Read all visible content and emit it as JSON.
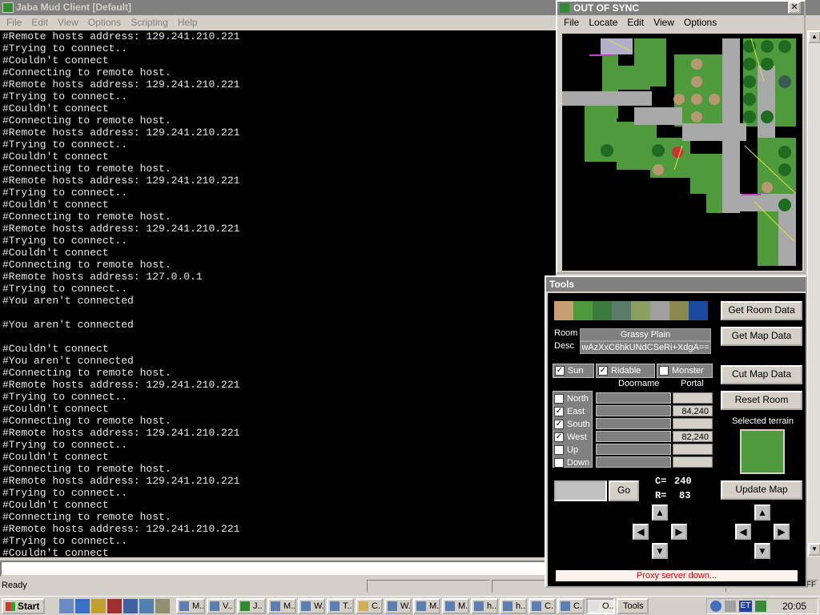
{
  "main": {
    "title": "Jaba Mud Client [Default]",
    "menu": [
      "File",
      "Edit",
      "View",
      "Options",
      "Scripting",
      "Help"
    ],
    "console_lines": [
      "#Remote hosts address: 129.241.210.221",
      "#Trying to connect..",
      "#Couldn't connect",
      "#Connecting to remote host.",
      "#Remote hosts address: 129.241.210.221",
      "#Trying to connect..",
      "#Couldn't connect",
      "#Connecting to remote host.",
      "#Remote hosts address: 129.241.210.221",
      "#Trying to connect..",
      "#Couldn't connect",
      "#Connecting to remote host.",
      "#Remote hosts address: 129.241.210.221",
      "#Trying to connect..",
      "#Couldn't connect",
      "#Connecting to remote host.",
      "#Remote hosts address: 129.241.210.221",
      "#Trying to connect..",
      "#Couldn't connect",
      "#Connecting to remote host.",
      "#Remote hosts address: 127.0.0.1",
      "#Trying to connect..",
      "#You aren't connected",
      "",
      "#You aren't connected",
      "",
      "#Couldn't connect",
      "#You aren't connected",
      "#Connecting to remote host.",
      "#Remote hosts address: 129.241.210.221",
      "#Trying to connect..",
      "#Couldn't connect",
      "#Connecting to remote host.",
      "#Remote hosts address: 129.241.210.221",
      "#Trying to connect..",
      "#Couldn't connect",
      "#Connecting to remote host.",
      "#Remote hosts address: 129.241.210.221",
      "#Trying to connect..",
      "#Couldn't connect",
      "#Connecting to remote host.",
      "#Remote hosts address: 129.241.210.221",
      "#Trying to connect..",
      "#Couldn't connect"
    ],
    "status": "Ready",
    "status_right": "FF"
  },
  "map_window": {
    "title": "OUT OF SYNC",
    "close": "✕",
    "menu": [
      "File",
      "Locate",
      "Edit",
      "View",
      "Options"
    ]
  },
  "tools": {
    "title": "Tools",
    "buttons": {
      "get_room_data": "Get Room Data",
      "get_map_data": "Get Map Data",
      "cut_map_data": "Cut Map Data",
      "reset_room": "Reset Room",
      "update_map": "Update Map",
      "go": "Go"
    },
    "room_label": "Room",
    "room_value": "Grassy Plain",
    "desc_label": "Desc",
    "desc_value": "wAzXxC6hkUNdCSeRi+XdgA==",
    "sun": "Sun",
    "ridable": "Ridable",
    "monster": "Monster",
    "doorname_header": "Doorname",
    "portal_header": "Portal",
    "directions": [
      {
        "name": "North",
        "checked": false,
        "portal": ""
      },
      {
        "name": "East",
        "checked": true,
        "portal": "84,240"
      },
      {
        "name": "South",
        "checked": true,
        "portal": ""
      },
      {
        "name": "West",
        "checked": true,
        "portal": "82,240"
      },
      {
        "name": "Up",
        "checked": false,
        "portal": ""
      },
      {
        "name": "Down",
        "checked": false,
        "portal": ""
      }
    ],
    "selected_terrain_label": "Selected terrain",
    "c_label": "C=",
    "c_value": "240",
    "r_label": "R=",
    "r_value": "83",
    "proxy_status": "Proxy server down...",
    "check": "✓"
  },
  "taskbar": {
    "start": "Start",
    "items": [
      "M..",
      "V..",
      "J..",
      "M..",
      "W..",
      "T..",
      "C..",
      "W..",
      "M..",
      "M..",
      "h..",
      "h..",
      "C..",
      "C..",
      "O..",
      "Tools"
    ],
    "clock": "20:05",
    "tray_et": "ET"
  },
  "colors": {
    "grass": "#4f9a3c",
    "road": "#a8a8a8",
    "console_bg": "#000000",
    "console_fg": "#e8e8e8",
    "proxy_text": "#cc0000"
  }
}
